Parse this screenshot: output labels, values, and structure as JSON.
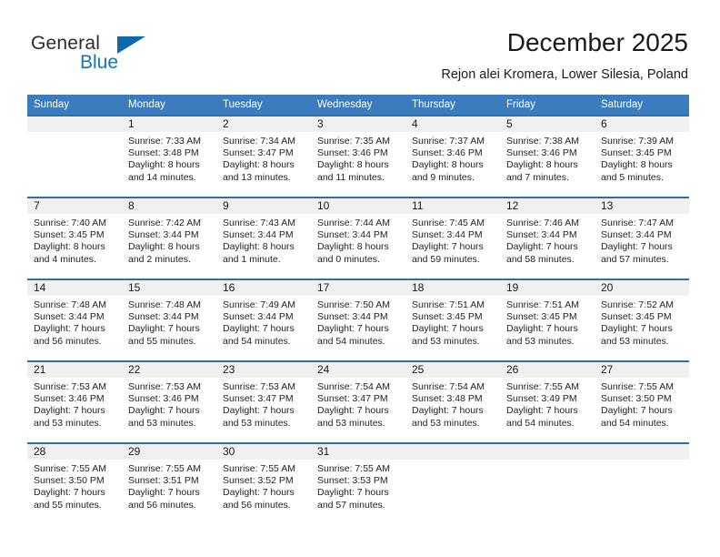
{
  "brand": {
    "name_part1": "General",
    "name_part2": "Blue",
    "flag_icon": "triangle-flag-icon",
    "accent_color": "#1574bb"
  },
  "header": {
    "title": "December 2025",
    "subtitle": "Rejon alei Kromera, Lower Silesia, Poland"
  },
  "calendar": {
    "header_bg": "#3a7cbe",
    "row_divider_color": "#2f6fae",
    "daynum_bg": "#f0f0f0",
    "weekday_headers": [
      "Sunday",
      "Monday",
      "Tuesday",
      "Wednesday",
      "Thursday",
      "Friday",
      "Saturday"
    ],
    "weeks": [
      [
        {
          "day": "",
          "sunrise": "",
          "sunset": "",
          "daylight1": "",
          "daylight2": ""
        },
        {
          "day": "1",
          "sunrise": "Sunrise: 7:33 AM",
          "sunset": "Sunset: 3:48 PM",
          "daylight1": "Daylight: 8 hours",
          "daylight2": "and 14 minutes."
        },
        {
          "day": "2",
          "sunrise": "Sunrise: 7:34 AM",
          "sunset": "Sunset: 3:47 PM",
          "daylight1": "Daylight: 8 hours",
          "daylight2": "and 13 minutes."
        },
        {
          "day": "3",
          "sunrise": "Sunrise: 7:35 AM",
          "sunset": "Sunset: 3:46 PM",
          "daylight1": "Daylight: 8 hours",
          "daylight2": "and 11 minutes."
        },
        {
          "day": "4",
          "sunrise": "Sunrise: 7:37 AM",
          "sunset": "Sunset: 3:46 PM",
          "daylight1": "Daylight: 8 hours",
          "daylight2": "and 9 minutes."
        },
        {
          "day": "5",
          "sunrise": "Sunrise: 7:38 AM",
          "sunset": "Sunset: 3:46 PM",
          "daylight1": "Daylight: 8 hours",
          "daylight2": "and 7 minutes."
        },
        {
          "day": "6",
          "sunrise": "Sunrise: 7:39 AM",
          "sunset": "Sunset: 3:45 PM",
          "daylight1": "Daylight: 8 hours",
          "daylight2": "and 5 minutes."
        }
      ],
      [
        {
          "day": "7",
          "sunrise": "Sunrise: 7:40 AM",
          "sunset": "Sunset: 3:45 PM",
          "daylight1": "Daylight: 8 hours",
          "daylight2": "and 4 minutes."
        },
        {
          "day": "8",
          "sunrise": "Sunrise: 7:42 AM",
          "sunset": "Sunset: 3:44 PM",
          "daylight1": "Daylight: 8 hours",
          "daylight2": "and 2 minutes."
        },
        {
          "day": "9",
          "sunrise": "Sunrise: 7:43 AM",
          "sunset": "Sunset: 3:44 PM",
          "daylight1": "Daylight: 8 hours",
          "daylight2": "and 1 minute."
        },
        {
          "day": "10",
          "sunrise": "Sunrise: 7:44 AM",
          "sunset": "Sunset: 3:44 PM",
          "daylight1": "Daylight: 8 hours",
          "daylight2": "and 0 minutes."
        },
        {
          "day": "11",
          "sunrise": "Sunrise: 7:45 AM",
          "sunset": "Sunset: 3:44 PM",
          "daylight1": "Daylight: 7 hours",
          "daylight2": "and 59 minutes."
        },
        {
          "day": "12",
          "sunrise": "Sunrise: 7:46 AM",
          "sunset": "Sunset: 3:44 PM",
          "daylight1": "Daylight: 7 hours",
          "daylight2": "and 58 minutes."
        },
        {
          "day": "13",
          "sunrise": "Sunrise: 7:47 AM",
          "sunset": "Sunset: 3:44 PM",
          "daylight1": "Daylight: 7 hours",
          "daylight2": "and 57 minutes."
        }
      ],
      [
        {
          "day": "14",
          "sunrise": "Sunrise: 7:48 AM",
          "sunset": "Sunset: 3:44 PM",
          "daylight1": "Daylight: 7 hours",
          "daylight2": "and 56 minutes."
        },
        {
          "day": "15",
          "sunrise": "Sunrise: 7:48 AM",
          "sunset": "Sunset: 3:44 PM",
          "daylight1": "Daylight: 7 hours",
          "daylight2": "and 55 minutes."
        },
        {
          "day": "16",
          "sunrise": "Sunrise: 7:49 AM",
          "sunset": "Sunset: 3:44 PM",
          "daylight1": "Daylight: 7 hours",
          "daylight2": "and 54 minutes."
        },
        {
          "day": "17",
          "sunrise": "Sunrise: 7:50 AM",
          "sunset": "Sunset: 3:44 PM",
          "daylight1": "Daylight: 7 hours",
          "daylight2": "and 54 minutes."
        },
        {
          "day": "18",
          "sunrise": "Sunrise: 7:51 AM",
          "sunset": "Sunset: 3:45 PM",
          "daylight1": "Daylight: 7 hours",
          "daylight2": "and 53 minutes."
        },
        {
          "day": "19",
          "sunrise": "Sunrise: 7:51 AM",
          "sunset": "Sunset: 3:45 PM",
          "daylight1": "Daylight: 7 hours",
          "daylight2": "and 53 minutes."
        },
        {
          "day": "20",
          "sunrise": "Sunrise: 7:52 AM",
          "sunset": "Sunset: 3:45 PM",
          "daylight1": "Daylight: 7 hours",
          "daylight2": "and 53 minutes."
        }
      ],
      [
        {
          "day": "21",
          "sunrise": "Sunrise: 7:53 AM",
          "sunset": "Sunset: 3:46 PM",
          "daylight1": "Daylight: 7 hours",
          "daylight2": "and 53 minutes."
        },
        {
          "day": "22",
          "sunrise": "Sunrise: 7:53 AM",
          "sunset": "Sunset: 3:46 PM",
          "daylight1": "Daylight: 7 hours",
          "daylight2": "and 53 minutes."
        },
        {
          "day": "23",
          "sunrise": "Sunrise: 7:53 AM",
          "sunset": "Sunset: 3:47 PM",
          "daylight1": "Daylight: 7 hours",
          "daylight2": "and 53 minutes."
        },
        {
          "day": "24",
          "sunrise": "Sunrise: 7:54 AM",
          "sunset": "Sunset: 3:47 PM",
          "daylight1": "Daylight: 7 hours",
          "daylight2": "and 53 minutes."
        },
        {
          "day": "25",
          "sunrise": "Sunrise: 7:54 AM",
          "sunset": "Sunset: 3:48 PM",
          "daylight1": "Daylight: 7 hours",
          "daylight2": "and 53 minutes."
        },
        {
          "day": "26",
          "sunrise": "Sunrise: 7:55 AM",
          "sunset": "Sunset: 3:49 PM",
          "daylight1": "Daylight: 7 hours",
          "daylight2": "and 54 minutes."
        },
        {
          "day": "27",
          "sunrise": "Sunrise: 7:55 AM",
          "sunset": "Sunset: 3:50 PM",
          "daylight1": "Daylight: 7 hours",
          "daylight2": "and 54 minutes."
        }
      ],
      [
        {
          "day": "28",
          "sunrise": "Sunrise: 7:55 AM",
          "sunset": "Sunset: 3:50 PM",
          "daylight1": "Daylight: 7 hours",
          "daylight2": "and 55 minutes."
        },
        {
          "day": "29",
          "sunrise": "Sunrise: 7:55 AM",
          "sunset": "Sunset: 3:51 PM",
          "daylight1": "Daylight: 7 hours",
          "daylight2": "and 56 minutes."
        },
        {
          "day": "30",
          "sunrise": "Sunrise: 7:55 AM",
          "sunset": "Sunset: 3:52 PM",
          "daylight1": "Daylight: 7 hours",
          "daylight2": "and 56 minutes."
        },
        {
          "day": "31",
          "sunrise": "Sunrise: 7:55 AM",
          "sunset": "Sunset: 3:53 PM",
          "daylight1": "Daylight: 7 hours",
          "daylight2": "and 57 minutes."
        },
        {
          "day": "",
          "sunrise": "",
          "sunset": "",
          "daylight1": "",
          "daylight2": ""
        },
        {
          "day": "",
          "sunrise": "",
          "sunset": "",
          "daylight1": "",
          "daylight2": ""
        },
        {
          "day": "",
          "sunrise": "",
          "sunset": "",
          "daylight1": "",
          "daylight2": ""
        }
      ]
    ]
  }
}
